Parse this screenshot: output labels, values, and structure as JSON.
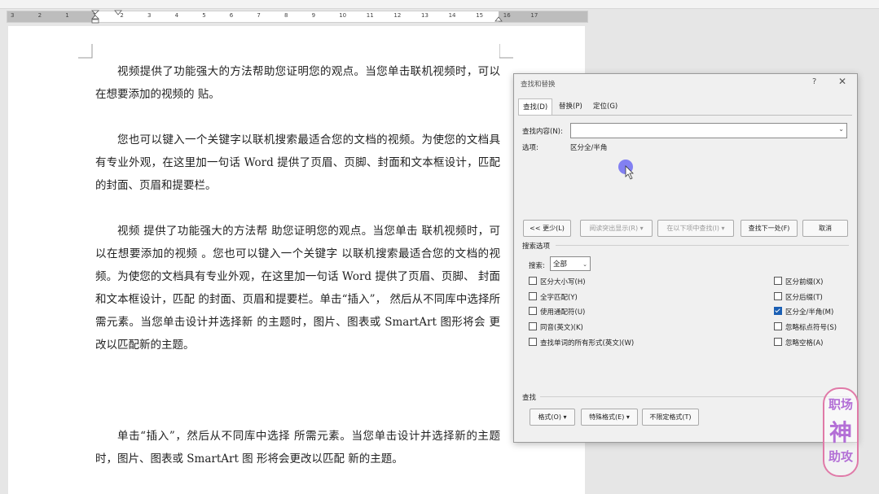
{
  "ruler": {
    "numbers": [
      "3",
      "2",
      "1",
      "1",
      "2",
      "3",
      "4",
      "5",
      "6",
      "7",
      "8",
      "9",
      "10",
      "11",
      "12",
      "13",
      "14",
      "15",
      "16",
      "17"
    ]
  },
  "document": {
    "paragraphs": [
      "视频提供了功能强大的方法帮助您证明您的观点。当您单击联机视频时，可以在想要添加的视频的  贴。",
      "您也可以键入一个关键字以联机搜索最适合您的文档的视频。为使您的文档具有专业外观，在这里加一句话 Word 提供了页眉、页脚、封面和文本框设计，匹配的封面、页眉和提要栏。",
      "视频    提供了功能强大的方法帮    助您证明您的观点。当您单击    联机视频时，可以在想要添加的视频            。您也可以键入一个关键字    以联机搜索最适合您的文档的视频。为使您的文档具有专业外观，在这里加一句话 Word 提供了页眉、页脚、    封面和文本框设计，匹配            的封面、页眉和提要栏。单击“插入”，    然后从不同库中选择所需元素。当您单击设计并选择新            的主题时，图片、图表或 SmartArt 图形将会        更改以匹配新的主题。",
      "单击“插入”，然后从不同库中选择    所需元素。当您单击设计并选择新的主题时，图片、图表或 SmartArt 图 形将会更改以匹配 新的主题。"
    ]
  },
  "dialog": {
    "title": "查找和替换",
    "help": "?",
    "close": "✕",
    "tabs": [
      "查找(D)",
      "替换(P)",
      "定位(G)"
    ],
    "find_label": "查找内容(N):",
    "find_value": "",
    "options_label": "选项:",
    "options_value": "区分全/半角",
    "buttons": {
      "less": "<< 更少(L)",
      "reading_highlight": "阅读突出显示(R) ▾",
      "find_in": "在以下项中查找(I) ▾",
      "find_next": "查找下一处(F)",
      "cancel": "取消"
    },
    "search_options_title": "搜索选项",
    "search_label": "搜索:",
    "search_value": "全部",
    "left_checks": [
      {
        "label": "区分大小写(H)",
        "checked": false
      },
      {
        "label": "全字匹配(Y)",
        "checked": false
      },
      {
        "label": "使用通配符(U)",
        "checked": false
      },
      {
        "label": "同音(英文)(K)",
        "checked": false
      },
      {
        "label": "查找单词的所有形式(英文)(W)",
        "checked": false
      }
    ],
    "right_checks": [
      {
        "label": "区分前缀(X)",
        "checked": false
      },
      {
        "label": "区分后缀(T)",
        "checked": false
      },
      {
        "label": "区分全/半角(M)",
        "checked": true
      },
      {
        "label": "忽略标点符号(S)",
        "checked": false
      },
      {
        "label": "忽略空格(A)",
        "checked": false
      }
    ],
    "find_section_title": "查找",
    "bottom_buttons": {
      "format": "格式(O) ▾",
      "special": "特殊格式(E) ▾",
      "no_format": "不限定格式(T)"
    }
  },
  "watermark": {
    "line1": "职场",
    "line2": "神",
    "line3": "助攻"
  },
  "colors": {
    "accent": "#1a5fb4",
    "cursor": "#6f6cf2",
    "watermark": "#b36fd6"
  }
}
